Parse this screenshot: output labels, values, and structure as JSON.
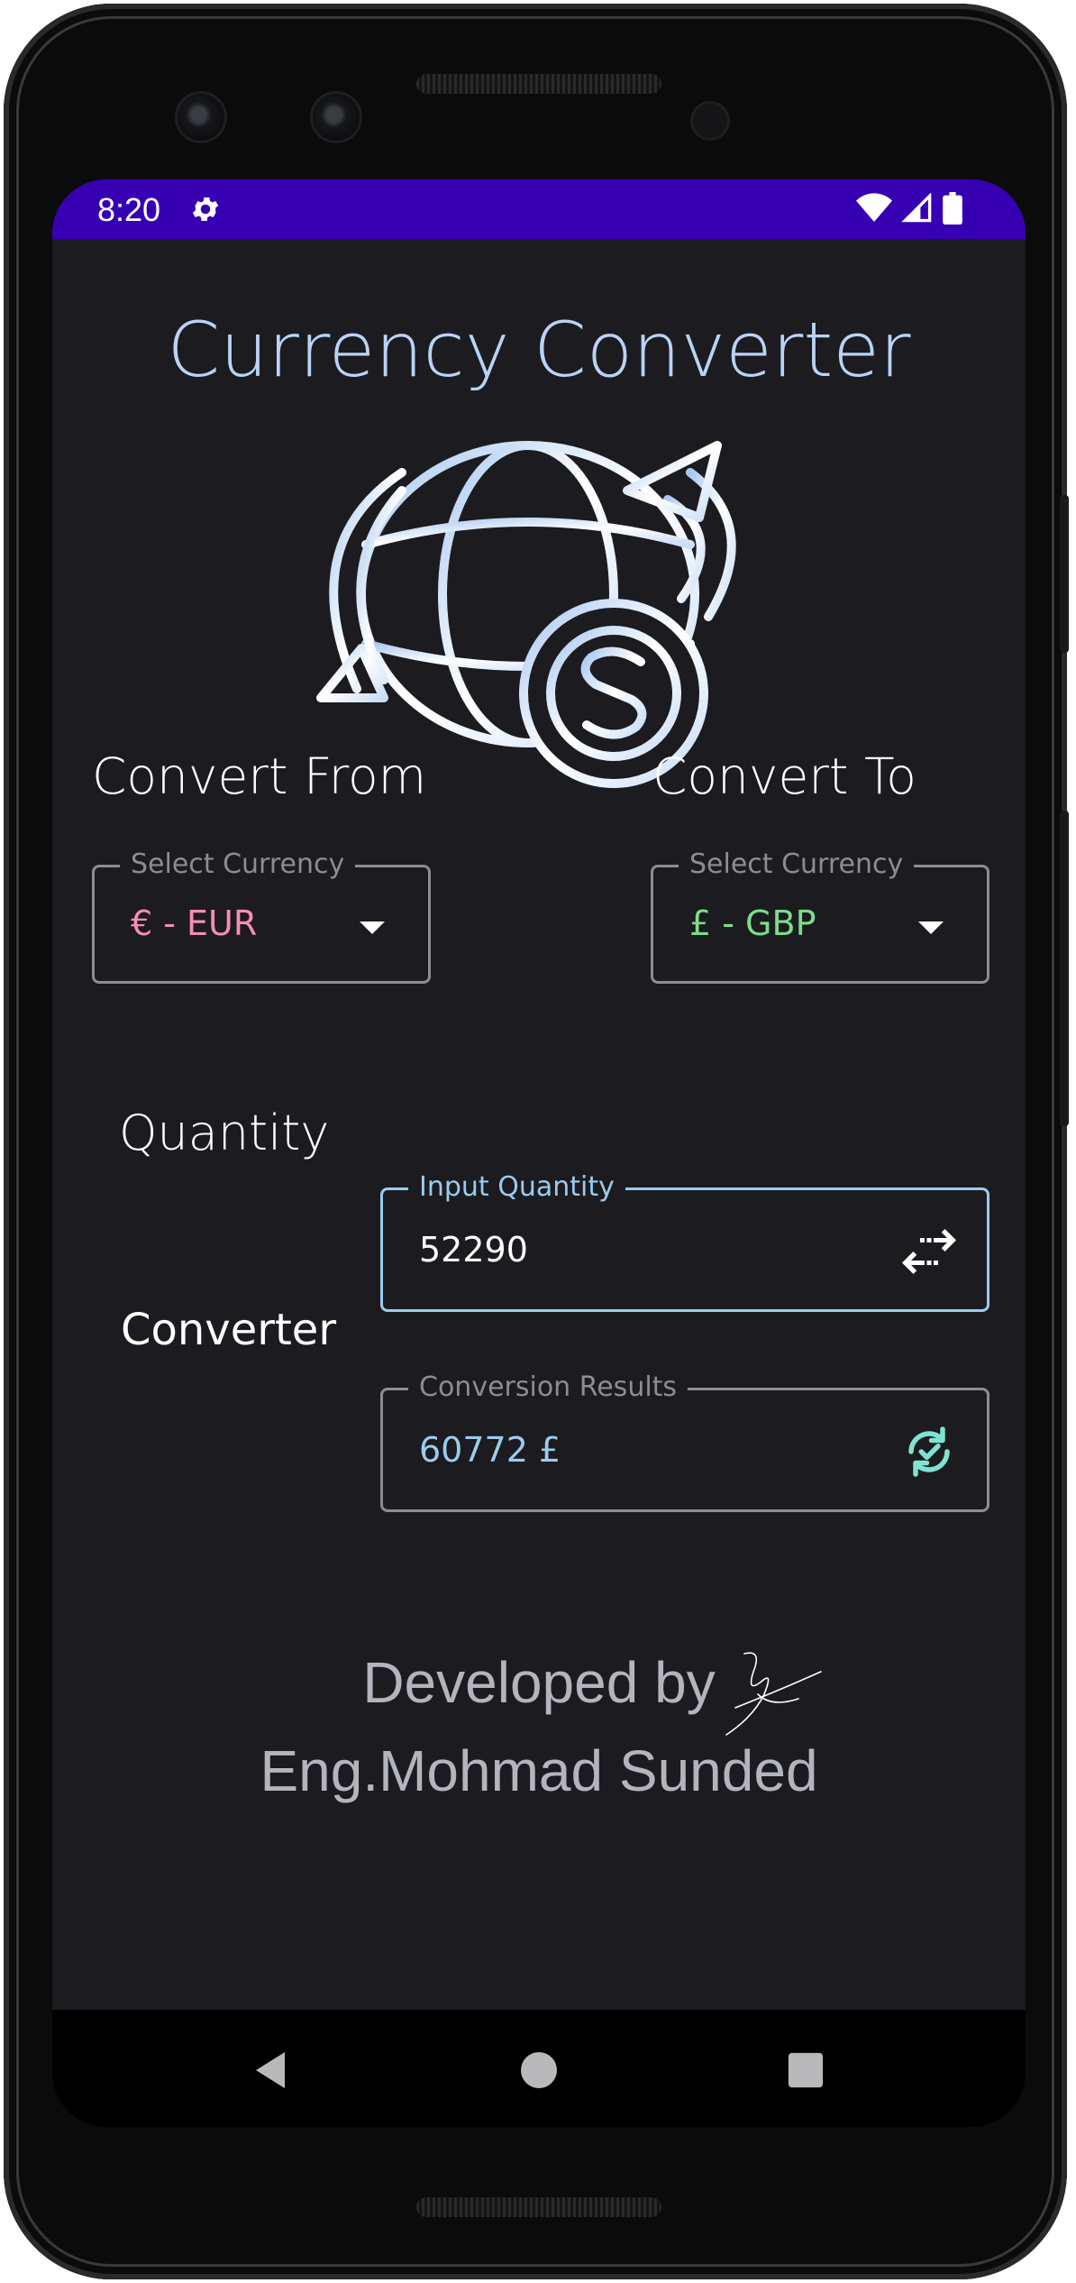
{
  "status_bar": {
    "time": "8:20",
    "icons": [
      "settings-gear-icon",
      "wifi-icon",
      "cell-signal-icon",
      "battery-icon"
    ],
    "background": "#3700b3"
  },
  "app": {
    "title": "Currency Converter",
    "logo_icon": "globe-exchange-dollar-icon"
  },
  "convert_from": {
    "label": "Convert From",
    "field_label": "Select Currency",
    "value": "€ - EUR",
    "value_color": "#f48fb1"
  },
  "convert_to": {
    "label": "Convert To",
    "field_label": "Select Currency",
    "value": "£ - GBP",
    "value_color": "#7ddc8c"
  },
  "quantity": {
    "label": "Quantity",
    "field_label": "Input Quantity",
    "value": "52290",
    "trailing_icon": "swap-arrows-icon"
  },
  "converter": {
    "label": "Converter",
    "field_label": "Conversion Results",
    "value": "60772 £",
    "value_color": "#9ccbee",
    "trailing_icon": "refresh-check-icon"
  },
  "footer": {
    "line1": "Developed by",
    "line2": "Eng.Mohmad Sunded"
  },
  "nav_bar": {
    "buttons": [
      "back-icon",
      "home-icon",
      "recents-icon"
    ]
  },
  "colors": {
    "background": "#1c1b1f",
    "accent": "#9ccbee",
    "title": "#b9d3f5"
  }
}
